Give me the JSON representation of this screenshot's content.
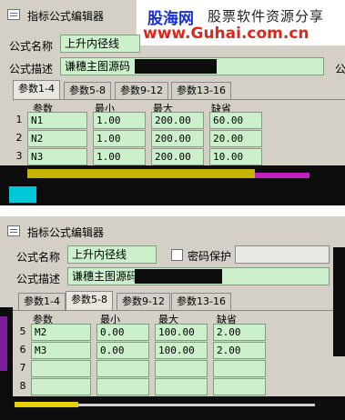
{
  "dialog_title": "指标公式编辑器",
  "watermark": {
    "brand": "股海网",
    "tagline": "股票软件资源分享",
    "url": "www.Guhai.com.cn"
  },
  "top": {
    "formula_name_label": "公式名称",
    "formula_name_value": "上升内径线",
    "formula_desc_label": "公式描述",
    "formula_desc_value": "谦穗主图源码",
    "right_edge_label": "公",
    "tabs": [
      "参数1-4",
      "参数5-8",
      "参数9-12",
      "参数13-16"
    ],
    "active_tab": 0,
    "headers": [
      "参数",
      "最小",
      "最大",
      "缺省"
    ],
    "rows": [
      {
        "num": "1",
        "name": "N1",
        "min": "1.00",
        "max": "200.00",
        "def": "60.00"
      },
      {
        "num": "2",
        "name": "N2",
        "min": "1.00",
        "max": "200.00",
        "def": "20.00"
      },
      {
        "num": "3",
        "name": "N3",
        "min": "1.00",
        "max": "200.00",
        "def": "10.00"
      }
    ]
  },
  "bottom": {
    "formula_name_label": "公式名称",
    "formula_name_value": "上升内径线",
    "password_label": "密码保护",
    "formula_desc_label": "公式描述",
    "formula_desc_value": "谦穗主图源码",
    "tabs": [
      "参数1-4",
      "参数5-8",
      "参数9-12",
      "参数13-16"
    ],
    "active_tab": 1,
    "headers": [
      "参数",
      "最小",
      "最大",
      "缺省"
    ],
    "rows": [
      {
        "num": "5",
        "name": "M2",
        "min": "0.00",
        "max": "100.00",
        "def": "2.00"
      },
      {
        "num": "6",
        "name": "M3",
        "min": "0.00",
        "max": "100.00",
        "def": "2.00"
      },
      {
        "num": "7",
        "name": "",
        "min": "",
        "max": "",
        "def": ""
      },
      {
        "num": "8",
        "name": "",
        "min": "",
        "max": "",
        "def": ""
      }
    ]
  },
  "icons": {
    "app": "window-app-icon",
    "checkbox": "checkbox-unchecked"
  }
}
